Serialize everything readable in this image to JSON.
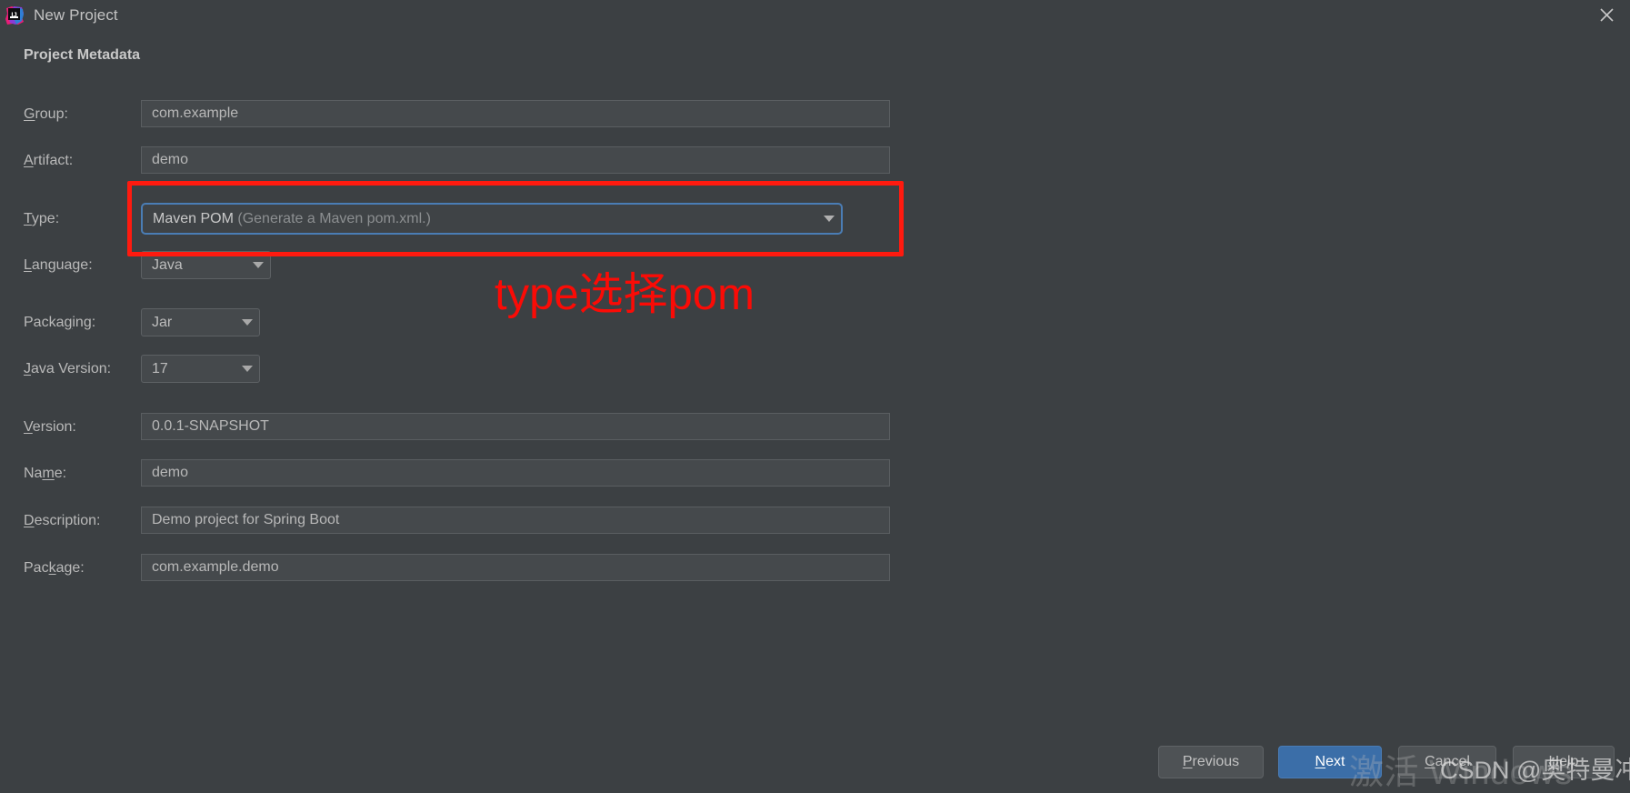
{
  "window": {
    "title": "New Project",
    "app_icon": "intellij-idea-icon",
    "close_icon": "close-icon"
  },
  "section": {
    "heading": "Project Metadata"
  },
  "fields": {
    "group": {
      "label_pre": "",
      "label_mnemonic": "G",
      "label_post": "roup:",
      "value": "com.example"
    },
    "artifact": {
      "label_pre": "",
      "label_mnemonic": "A",
      "label_post": "rtifact:",
      "value": "demo"
    },
    "type": {
      "label_pre": "",
      "label_mnemonic": "T",
      "label_post": "ype:",
      "value": "Maven POM",
      "hint": " (Generate a Maven pom.xml.)",
      "dropdown_icon": "chevron-down-icon"
    },
    "language": {
      "label_pre": "",
      "label_mnemonic": "L",
      "label_post": "anguage:",
      "value": "Java",
      "dropdown_icon": "chevron-down-icon"
    },
    "packaging": {
      "label_pre": "Packa",
      "label_mnemonic": "g",
      "label_post": "ing:",
      "value": "Jar",
      "dropdown_icon": "chevron-down-icon"
    },
    "java_version": {
      "label_pre": "",
      "label_mnemonic": "J",
      "label_post": "ava Version:",
      "value": "17",
      "dropdown_icon": "chevron-down-icon"
    },
    "version": {
      "label_pre": "",
      "label_mnemonic": "V",
      "label_post": "ersion:",
      "value": "0.0.1-SNAPSHOT"
    },
    "name": {
      "label_pre": "Na",
      "label_mnemonic": "m",
      "label_post": "e:",
      "value": "demo"
    },
    "description": {
      "label_pre": "",
      "label_mnemonic": "D",
      "label_post": "escription:",
      "value": "Demo project for Spring Boot"
    },
    "package": {
      "label_pre": "Pac",
      "label_mnemonic": "k",
      "label_post": "age:",
      "value": "com.example.demo"
    }
  },
  "annotation": {
    "text": "type选择pom",
    "color": "#fb0b06",
    "box_color": "#ff1a0f"
  },
  "buttons": {
    "previous": {
      "pre": "",
      "mnemonic": "P",
      "post": "revious"
    },
    "next": {
      "pre": "",
      "mnemonic": "N",
      "post": "ext"
    },
    "cancel": {
      "pre": "",
      "mnemonic": "C",
      "post": "ancel"
    },
    "help": {
      "pre": "",
      "mnemonic": "H",
      "post": "elp"
    }
  },
  "watermarks": {
    "windows_activation": "激活 Windows",
    "csdn": "CSDN @奥特曼冲击波"
  },
  "colors": {
    "background": "#3c4043",
    "field_background": "#45494c",
    "accent_blue": "#3b6ea8",
    "focus_border": "#4a7db5",
    "annotation_red": "#fb0b06"
  }
}
